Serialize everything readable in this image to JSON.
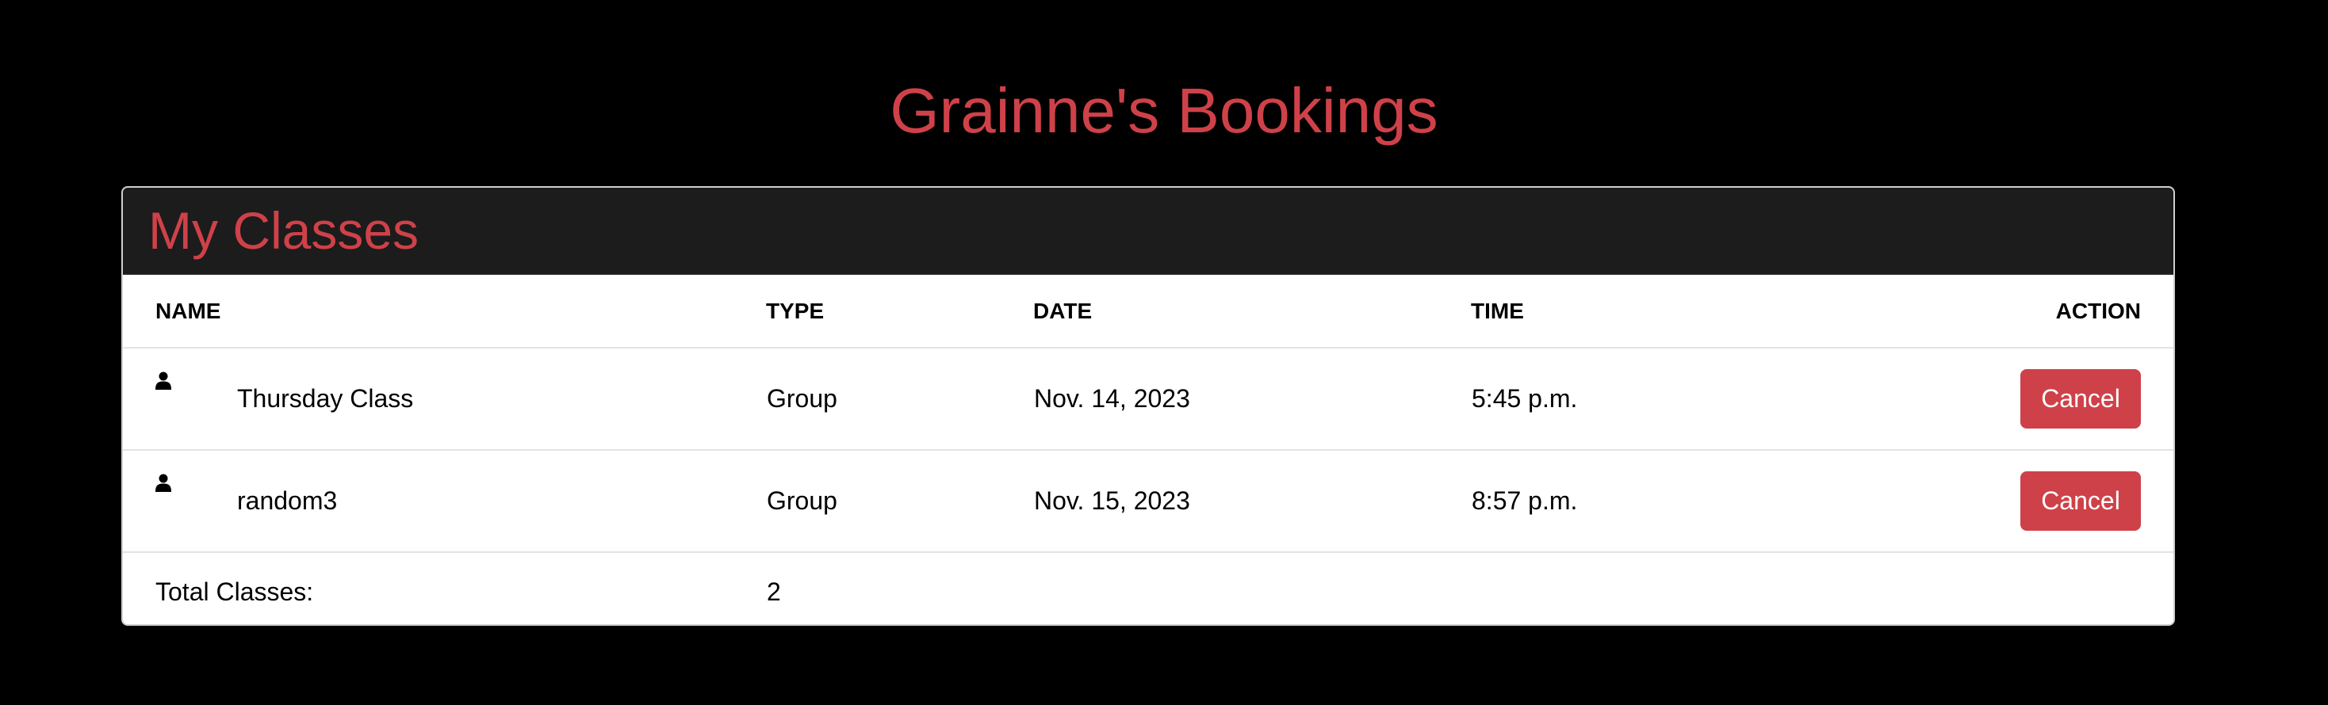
{
  "page": {
    "title": "Grainne's Bookings"
  },
  "card": {
    "title": "My Classes"
  },
  "table": {
    "headers": {
      "name": "NAME",
      "type": "TYPE",
      "date": "DATE",
      "time": "TIME",
      "action": "ACTION"
    },
    "rows": [
      {
        "icon": "user-icon",
        "name": "Thursday Class",
        "type": "Group",
        "date": "Nov. 14, 2023",
        "time": "5:45 p.m.",
        "action": "Cancel"
      },
      {
        "icon": "user-icon",
        "name": "random3",
        "type": "Group",
        "date": "Nov. 15, 2023",
        "time": "8:57 p.m.",
        "action": "Cancel"
      }
    ],
    "footer": {
      "label": "Total Classes:",
      "count": "2"
    }
  },
  "colors": {
    "accent": "#cf4149",
    "background": "#000000",
    "card_header": "#1c1c1c"
  }
}
